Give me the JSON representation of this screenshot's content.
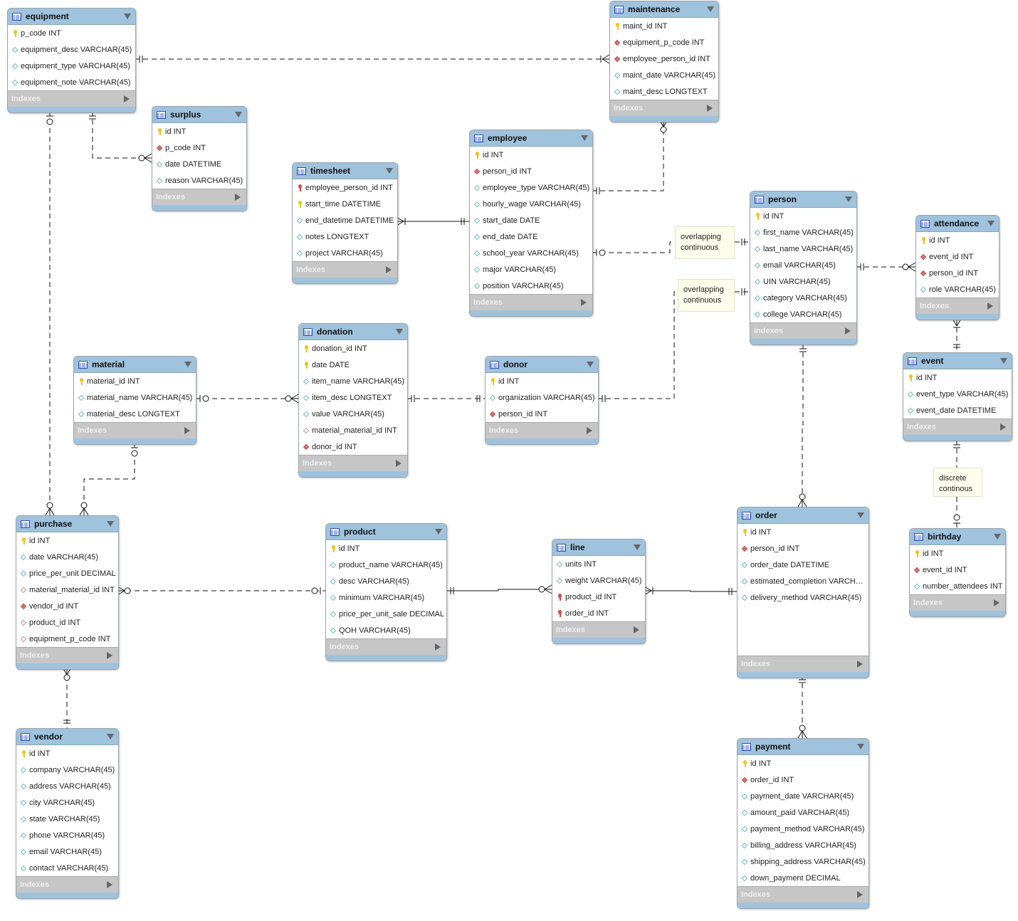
{
  "tables": [
    {
      "name": "equipment",
      "columns": [
        {
          "text": "p_code INT",
          "icon": "pk"
        },
        {
          "text": "equipment_desc VARCHAR(45)",
          "icon": "col"
        },
        {
          "text": "equipment_type VARCHAR(45)",
          "icon": "col"
        },
        {
          "text": "equipment_note VARCHAR(45)",
          "icon": "col"
        }
      ]
    },
    {
      "name": "maintenance",
      "columns": [
        {
          "text": "maint_id INT",
          "icon": "pk"
        },
        {
          "text": "equipment_p_code INT",
          "icon": "fk"
        },
        {
          "text": "employee_person_id INT",
          "icon": "fk"
        },
        {
          "text": "maint_date VARCHAR(45)",
          "icon": "col"
        },
        {
          "text": "maint_desc LONGTEXT",
          "icon": "col"
        }
      ]
    },
    {
      "name": "surplus",
      "columns": [
        {
          "text": "id INT",
          "icon": "pk"
        },
        {
          "text": "p_code INT",
          "icon": "fk"
        },
        {
          "text": "date DATETIME",
          "icon": "col"
        },
        {
          "text": "reason VARCHAR(45)",
          "icon": "col"
        }
      ]
    },
    {
      "name": "timesheet",
      "columns": [
        {
          "text": "employee_person_id INT",
          "icon": "pkfk"
        },
        {
          "text": "start_time DATETIME",
          "icon": "pk"
        },
        {
          "text": "end_datetime DATETIME",
          "icon": "col"
        },
        {
          "text": "notes LONGTEXT",
          "icon": "col"
        },
        {
          "text": "project VARCHAR(45)",
          "icon": "col"
        }
      ]
    },
    {
      "name": "employee",
      "columns": [
        {
          "text": "id INT",
          "icon": "pk"
        },
        {
          "text": "person_id INT",
          "icon": "fk"
        },
        {
          "text": "employee_type VARCHAR(45)",
          "icon": "col"
        },
        {
          "text": "hourly_wage VARCHAR(45)",
          "icon": "col"
        },
        {
          "text": "start_date DATE",
          "icon": "col"
        },
        {
          "text": "end_date DATE",
          "icon": "col"
        },
        {
          "text": "school_year VARCHAR(45)",
          "icon": "col"
        },
        {
          "text": "major VARCHAR(45)",
          "icon": "col"
        },
        {
          "text": "position VARCHAR(45)",
          "icon": "col"
        }
      ]
    },
    {
      "name": "person",
      "columns": [
        {
          "text": "id INT",
          "icon": "pk"
        },
        {
          "text": "first_name VARCHAR(45)",
          "icon": "col"
        },
        {
          "text": "last_name VARCHAR(45)",
          "icon": "col"
        },
        {
          "text": "email VARCHAR(45)",
          "icon": "col"
        },
        {
          "text": "UIN VARCHAR(45)",
          "icon": "col"
        },
        {
          "text": "category VARCHAR(45)",
          "icon": "col"
        },
        {
          "text": "college VARCHAR(45)",
          "icon": "col"
        }
      ]
    },
    {
      "name": "attendance",
      "columns": [
        {
          "text": "id INT",
          "icon": "pk"
        },
        {
          "text": "event_id INT",
          "icon": "fk"
        },
        {
          "text": "person_id INT",
          "icon": "fk"
        },
        {
          "text": "role VARCHAR(45)",
          "icon": "col"
        }
      ]
    },
    {
      "name": "event",
      "columns": [
        {
          "text": "id INT",
          "icon": "pk"
        },
        {
          "text": "event_type VARCHAR(45)",
          "icon": "col"
        },
        {
          "text": "event_date DATETIME",
          "icon": "col"
        }
      ]
    },
    {
      "name": "birthday",
      "columns": [
        {
          "text": "id INT",
          "icon": "pk"
        },
        {
          "text": "event_id INT",
          "icon": "fk"
        },
        {
          "text": "number_attendees INT",
          "icon": "col"
        }
      ]
    },
    {
      "name": "material",
      "columns": [
        {
          "text": "material_id INT",
          "icon": "pk"
        },
        {
          "text": "material_name VARCHAR(45)",
          "icon": "col"
        },
        {
          "text": "material_desc LONGTEXT",
          "icon": "col"
        }
      ]
    },
    {
      "name": "donation",
      "columns": [
        {
          "text": "donation_id INT",
          "icon": "pk"
        },
        {
          "text": "date DATE",
          "icon": "pk"
        },
        {
          "text": "item_name VARCHAR(45)",
          "icon": "col"
        },
        {
          "text": "item_desc LONGTEXT",
          "icon": "col"
        },
        {
          "text": "value VARCHAR(45)",
          "icon": "col"
        },
        {
          "text": "material_material_id INT",
          "icon": "fkn"
        },
        {
          "text": "donor_id INT",
          "icon": "fk"
        }
      ]
    },
    {
      "name": "donor",
      "columns": [
        {
          "text": "id INT",
          "icon": "pk"
        },
        {
          "text": "organization VARCHAR(45)",
          "icon": "col"
        },
        {
          "text": "person_id INT",
          "icon": "fk"
        }
      ]
    },
    {
      "name": "purchase",
      "columns": [
        {
          "text": "id INT",
          "icon": "pk"
        },
        {
          "text": "date VARCHAR(45)",
          "icon": "col"
        },
        {
          "text": "price_per_unit DECIMAL",
          "icon": "col"
        },
        {
          "text": "material_material_id INT",
          "icon": "fkn"
        },
        {
          "text": "vendor_id INT",
          "icon": "fk"
        },
        {
          "text": "product_id INT",
          "icon": "fkn"
        },
        {
          "text": "equipment_p_code INT",
          "icon": "fkn"
        }
      ]
    },
    {
      "name": "product",
      "columns": [
        {
          "text": "id INT",
          "icon": "pk"
        },
        {
          "text": "product_name VARCHAR(45)",
          "icon": "col"
        },
        {
          "text": "desc VARCHAR(45)",
          "icon": "col"
        },
        {
          "text": "minimum VARCHAR(45)",
          "icon": "col"
        },
        {
          "text": "price_per_unit_sale DECIMAL",
          "icon": "col"
        },
        {
          "text": "QOH VARCHAR(45)",
          "icon": "col"
        }
      ]
    },
    {
      "name": "line",
      "columns": [
        {
          "text": "units INT",
          "icon": "col"
        },
        {
          "text": "weight VARCHAR(45)",
          "icon": "col"
        },
        {
          "text": "product_id INT",
          "icon": "pkfk"
        },
        {
          "text": "order_id INT",
          "icon": "pkfk"
        }
      ]
    },
    {
      "name": "order",
      "columns": [
        {
          "text": "id INT",
          "icon": "pk"
        },
        {
          "text": "person_id INT",
          "icon": "fk"
        },
        {
          "text": "order_date DATETIME",
          "icon": "col"
        },
        {
          "text": "estimated_completion VARCH…",
          "icon": "col"
        },
        {
          "text": "delivery_method VARCHAR(45)",
          "icon": "col"
        }
      ]
    },
    {
      "name": "payment",
      "columns": [
        {
          "text": "id INT",
          "icon": "pk"
        },
        {
          "text": "order_id INT",
          "icon": "fk"
        },
        {
          "text": "payment_date VARCHAR(45)",
          "icon": "col"
        },
        {
          "text": "amount_paid VARCHAR(45)",
          "icon": "col"
        },
        {
          "text": "payment_method VARCHAR(45)",
          "icon": "col"
        },
        {
          "text": "billing_address VARCHAR(45)",
          "icon": "col"
        },
        {
          "text": "shipping_address VARCHAR(45)",
          "icon": "col"
        },
        {
          "text": "down_payment DECIMAL",
          "icon": "col"
        }
      ]
    },
    {
      "name": "vendor",
      "columns": [
        {
          "text": "id INT",
          "icon": "pk"
        },
        {
          "text": "company VARCHAR(45)",
          "icon": "col"
        },
        {
          "text": "address VARCHAR(45)",
          "icon": "col"
        },
        {
          "text": "city VARCHAR(45)",
          "icon": "col"
        },
        {
          "text": "state VARCHAR(45)",
          "icon": "col"
        },
        {
          "text": "phone VARCHAR(45)",
          "icon": "col"
        },
        {
          "text": "email VARCHAR(45)",
          "icon": "col"
        },
        {
          "text": "contact VARCHAR(45)",
          "icon": "col"
        }
      ]
    }
  ],
  "indexes_label": "Indexes",
  "notes": [
    {
      "lines": [
        "overlapping",
        "continuous"
      ]
    },
    {
      "lines": [
        "overlapping",
        "continuous"
      ]
    },
    {
      "lines": [
        "discrete",
        "continous"
      ]
    }
  ],
  "relationships": [
    {
      "from": "equipment",
      "to": "maintenance",
      "from_card": "one",
      "to_card": "many",
      "identifying": false
    },
    {
      "from": "equipment",
      "to": "surplus",
      "from_card": "one",
      "to_card": "zero-many",
      "identifying": false
    },
    {
      "from": "equipment",
      "to": "purchase",
      "from_card": "zero-one",
      "to_card": "zero-many",
      "identifying": false
    },
    {
      "from": "material",
      "to": "purchase",
      "from_card": "zero-one",
      "to_card": "zero-many",
      "identifying": false
    },
    {
      "from": "material",
      "to": "donation",
      "from_card": "zero-one",
      "to_card": "zero-many",
      "identifying": false
    },
    {
      "from": "donation",
      "to": "donor",
      "from_card": "one",
      "to_card": "one",
      "identifying": false
    },
    {
      "from": "donor",
      "to": "person",
      "from_card": "one",
      "to_card": "one",
      "identifying": false
    },
    {
      "from": "employee",
      "to": "person",
      "from_card": "zero-one",
      "to_card": "one",
      "identifying": false
    },
    {
      "from": "employee",
      "to": "maintenance",
      "from_card": "one",
      "to_card": "zero-many",
      "identifying": false
    },
    {
      "from": "timesheet",
      "to": "employee",
      "from_card": "many",
      "to_card": "one",
      "identifying": true
    },
    {
      "from": "person",
      "to": "attendance",
      "from_card": "one",
      "to_card": "zero-many",
      "identifying": false
    },
    {
      "from": "attendance",
      "to": "event",
      "from_card": "many",
      "to_card": "one",
      "identifying": false
    },
    {
      "from": "event",
      "to": "birthday",
      "from_card": "one",
      "to_card": "zero-one",
      "identifying": false
    },
    {
      "from": "person",
      "to": "order",
      "from_card": "one",
      "to_card": "zero-many",
      "identifying": false
    },
    {
      "from": "purchase",
      "to": "product",
      "from_card": "zero-many",
      "to_card": "zero-one",
      "identifying": false
    },
    {
      "from": "product",
      "to": "line",
      "from_card": "one",
      "to_card": "zero-many",
      "identifying": true
    },
    {
      "from": "line",
      "to": "order",
      "from_card": "many",
      "to_card": "one",
      "identifying": true
    },
    {
      "from": "order",
      "to": "payment",
      "from_card": "one",
      "to_card": "zero-many",
      "identifying": false
    },
    {
      "from": "purchase",
      "to": "vendor",
      "from_card": "zero-many",
      "to_card": "one",
      "identifying": false
    }
  ],
  "colors": {
    "header": "#9fc2dd",
    "indexes": "#c6c6c6",
    "note": "#fdfdec",
    "pk": "#f0c419",
    "fk": "#d47070",
    "column": "#6cb8c6"
  }
}
